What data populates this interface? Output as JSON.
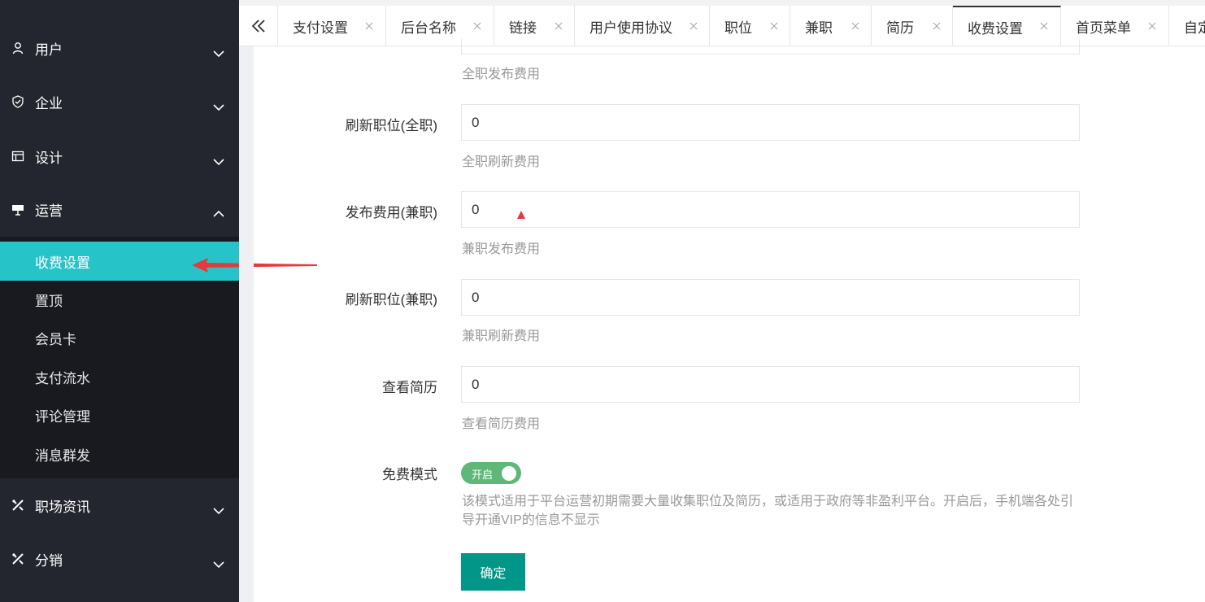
{
  "sidebar": {
    "items": [
      {
        "label": "用户",
        "icon": "user-icon",
        "expanded": false
      },
      {
        "label": "企业",
        "icon": "shield-check-icon",
        "expanded": false
      },
      {
        "label": "设计",
        "icon": "layout-icon",
        "expanded": false
      },
      {
        "label": "运营",
        "icon": "presentation-icon",
        "expanded": true
      },
      {
        "label": "职场资讯",
        "icon": "tools-icon",
        "expanded": false
      },
      {
        "label": "分销",
        "icon": "tools-icon",
        "expanded": false
      }
    ],
    "submenu": [
      {
        "label": "收费设置",
        "active": true
      },
      {
        "label": "置顶",
        "active": false
      },
      {
        "label": "会员卡",
        "active": false
      },
      {
        "label": "支付流水",
        "active": false
      },
      {
        "label": "评论管理",
        "active": false
      },
      {
        "label": "消息群发",
        "active": false
      }
    ]
  },
  "tabs": [
    {
      "label": "支付设置"
    },
    {
      "label": "后台名称"
    },
    {
      "label": "链接"
    },
    {
      "label": "用户使用协议"
    },
    {
      "label": "职位"
    },
    {
      "label": "兼职"
    },
    {
      "label": "简历"
    },
    {
      "label": "收费设置",
      "active": true
    },
    {
      "label": "首页菜单"
    },
    {
      "label": "自定"
    }
  ],
  "form": {
    "fulltime_publish_hint": "全职发布费用",
    "fields": [
      {
        "label": "刷新职位(全职)",
        "value": "0",
        "hint": "全职刷新费用"
      },
      {
        "label": "发布费用(兼职)",
        "value": "0",
        "hint": "兼职发布费用"
      },
      {
        "label": "刷新职位(兼职)",
        "value": "0",
        "hint": "兼职刷新费用"
      },
      {
        "label": "查看简历",
        "value": "0",
        "hint": "查看简历费用"
      }
    ],
    "free_mode": {
      "label": "免费模式",
      "toggle_text": "开启",
      "on": true,
      "description": "该模式适用于平台运营初期需要大量收集职位及简历，或适用于政府等非盈利平台。开启后，手机端各处引导开通VIP的信息不显示"
    },
    "submit_label": "确定"
  },
  "colors": {
    "sidebar_bg": "#23262e",
    "submenu_bg": "#191a20",
    "active_item": "#26c4c9",
    "toggle_on": "#5fb878",
    "submit": "#009688",
    "annotation": "#e5393c"
  }
}
